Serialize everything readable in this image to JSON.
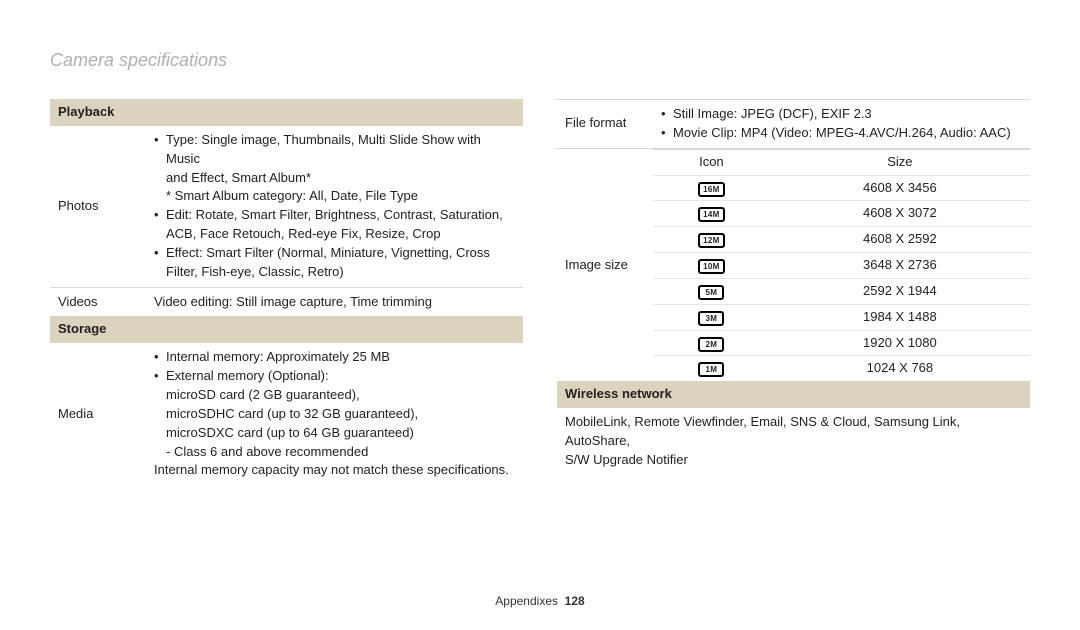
{
  "page_title": "Camera specifications",
  "left": {
    "section1": {
      "header": "Playback"
    },
    "photos": {
      "label": "Photos",
      "type_line1": "Type: Single image, Thumbnails, Multi Slide Show with Music",
      "type_line2": "and Effect, Smart Album*",
      "type_note": "* Smart Album category: All, Date, File Type",
      "edit_line1": "Edit: Rotate, Smart Filter, Brightness, Contrast, Saturation,",
      "edit_line2": "ACB, Face Retouch, Red-eye Fix, Resize, Crop",
      "effect_line1": "Effect: Smart Filter (Normal, Miniature, Vignetting, Cross",
      "effect_line2": "Filter, Fish-eye, Classic, Retro)"
    },
    "videos": {
      "label": "Videos",
      "value": "Video editing: Still image capture, Time trimming"
    },
    "section2": {
      "header": "Storage"
    },
    "media": {
      "label": "Media",
      "mem": "Internal memory: Approximately 25 MB",
      "ext_head": "External memory (Optional):",
      "ext_l1": "microSD card (2 GB guaranteed),",
      "ext_l2": "microSDHC card (up to 32 GB guaranteed),",
      "ext_l3": "microSDXC card (up to 64 GB guaranteed)",
      "ext_l4": "- Class 6 and above recommended",
      "note": "Internal memory capacity may not match these specifications."
    }
  },
  "right": {
    "fileformat": {
      "label": "File format",
      "b1": "Still Image: JPEG (DCF), EXIF 2.3",
      "b2": "Movie Clip: MP4 (Video: MPEG-4.AVC/H.264, Audio: AAC)"
    },
    "imagesize": {
      "label": "Image size",
      "head_icon": "Icon",
      "head_size": "Size",
      "rows": [
        {
          "icon": "16M",
          "size": "4608 X 3456"
        },
        {
          "icon": "14M",
          "size": "4608 X 3072"
        },
        {
          "icon": "12M",
          "size": "4608 X 2592"
        },
        {
          "icon": "10M",
          "size": "3648 X 2736"
        },
        {
          "icon": "5M",
          "size": "2592 X 1944"
        },
        {
          "icon": "3M",
          "size": "1984 X 1488"
        },
        {
          "icon": "2M",
          "size": "1920 X 1080"
        },
        {
          "icon": "1M",
          "size": "1024 X 768"
        }
      ]
    },
    "wireless": {
      "header": "Wireless network",
      "l1": "MobileLink, Remote Viewfinder, Email, SNS & Cloud, Samsung Link, AutoShare,",
      "l2": "S/W Upgrade Notifier"
    }
  },
  "footer": {
    "section": "Appendixes",
    "page_no": "128"
  }
}
